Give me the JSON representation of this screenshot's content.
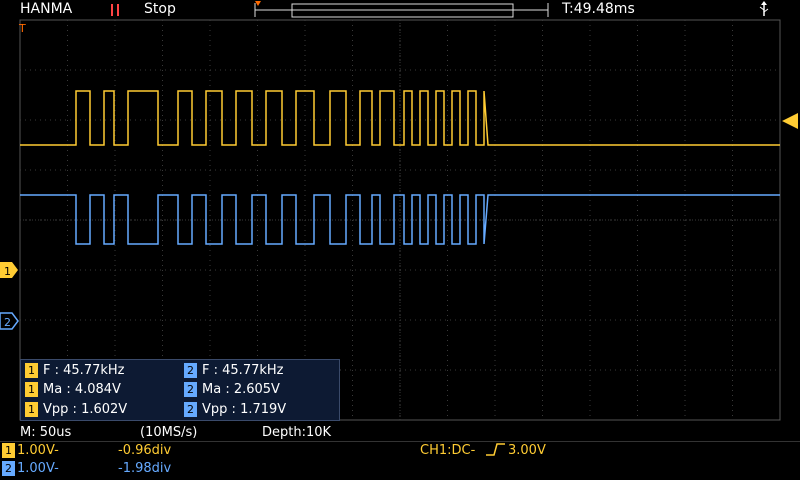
{
  "header": {
    "brand": "HANMA",
    "run_state_icon": "pause-bars-icon",
    "run_state": "Stop",
    "trigger_time": "T:49.48ms",
    "usb_icon": "usb-icon"
  },
  "colors": {
    "ch1": "#ffcc33",
    "ch2": "#66aaff",
    "grid": "#3a3a3a",
    "trigger_marker": "#ff6a00"
  },
  "markers": {
    "ch1_label": "1",
    "ch2_label": "2",
    "trigger_label": "T"
  },
  "measurements": {
    "ch1": [
      {
        "label": "F",
        "value": "45.77kHz"
      },
      {
        "label": "Ma",
        "value": "4.084V"
      },
      {
        "label": "Vpp",
        "value": "1.602V"
      }
    ],
    "ch2": [
      {
        "label": "F",
        "value": "45.77kHz"
      },
      {
        "label": "Ma",
        "value": "2.605V"
      },
      {
        "label": "Vpp",
        "value": "1.719V"
      }
    ]
  },
  "status": {
    "timebase": "M: 50us",
    "sample_rate": "(10MS/s)",
    "depth": "Depth:10K",
    "ch1_scale": "1.00V-",
    "ch1_offset": "-0.96div",
    "ch2_scale": "1.00V-",
    "ch2_offset": "-1.98div",
    "trigger": "CH1:DC-",
    "trigger_level": "3.00V"
  }
}
